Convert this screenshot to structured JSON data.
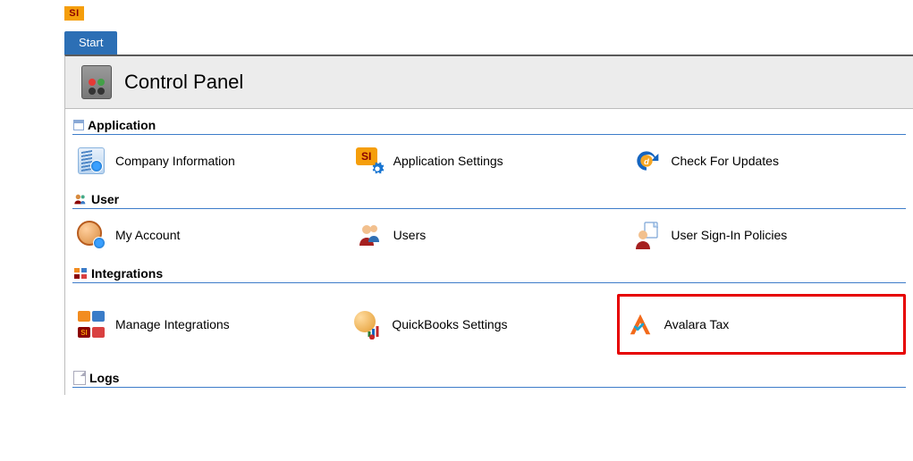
{
  "app_badge": "SI",
  "tabs": {
    "start": "Start"
  },
  "title": "Control Panel",
  "sections": {
    "application": {
      "label": "Application",
      "items": {
        "company_information": "Company Information",
        "application_settings": "Application Settings",
        "check_for_updates": "Check For Updates"
      }
    },
    "user": {
      "label": "User",
      "items": {
        "my_account": "My Account",
        "users": "Users",
        "user_signin_policies": "User Sign-In Policies"
      }
    },
    "integrations": {
      "label": "Integrations",
      "items": {
        "manage_integrations": "Manage Integrations",
        "quickbooks_settings": "QuickBooks Settings",
        "avalara_tax": "Avalara Tax"
      }
    },
    "logs": {
      "label": "Logs"
    }
  }
}
